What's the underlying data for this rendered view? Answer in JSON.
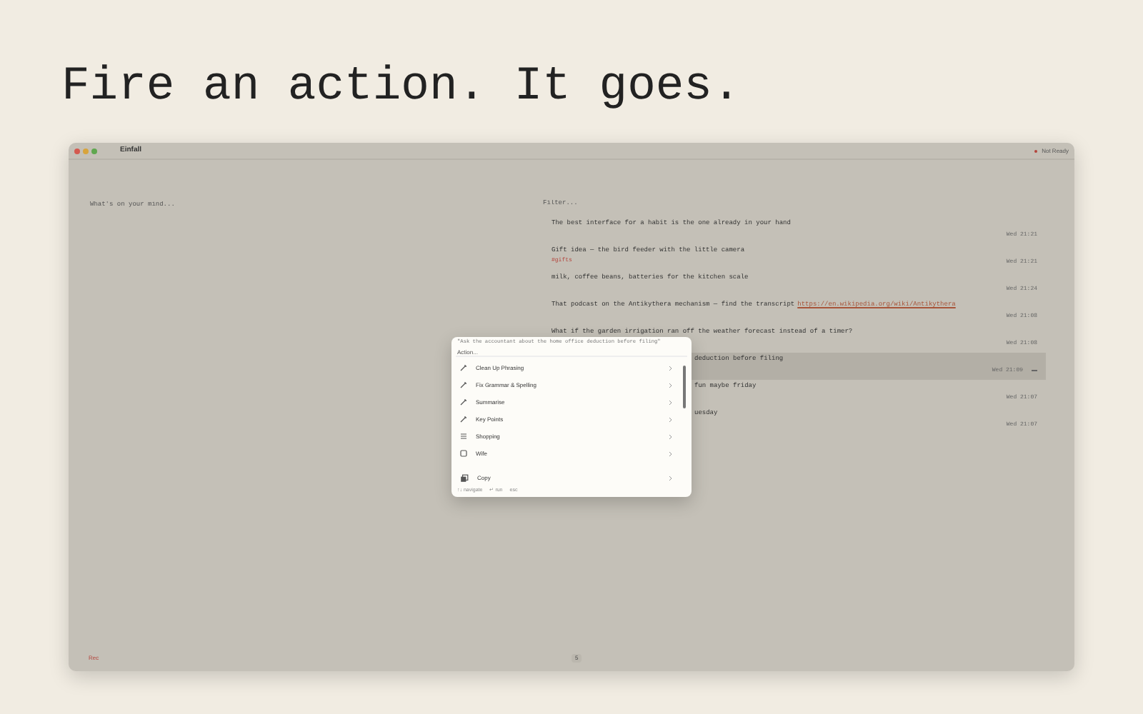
{
  "headline": "Fire an action. It goes.",
  "window": {
    "title": "Einfall",
    "status": "Not Ready"
  },
  "composer": {
    "placeholder": "What's on your mind..."
  },
  "filter": {
    "placeholder": "Filter..."
  },
  "notes": [
    {
      "text": "The best interface for a habit is the one already in your hand",
      "time": "Wed 21:21",
      "selected": false
    },
    {
      "text": "Gift idea — the bird feeder with the little camera",
      "tag": "#gifts",
      "time": "Wed 21:21",
      "selected": false
    },
    {
      "text": "milk, coffee beans, batteries for the kitchen scale",
      "time": "Wed 21:24",
      "selected": false
    },
    {
      "text": "That podcast on the Antikythera mechanism — find the transcript",
      "link": "https://en.wikipedia.org/wiki/Antikythera",
      "time": "Wed 21:08",
      "selected": false
    },
    {
      "text": "What if the garden irrigation ran off the weather forecast instead of a timer?",
      "time": "Wed 21:08",
      "selected": false
    },
    {
      "text": "deduction before filing",
      "time": "Wed 21:09",
      "selected": true,
      "kind": "overlapped"
    },
    {
      "text": "fun maybe friday",
      "time": "Wed 21:07",
      "selected": false,
      "kind": "overlapped"
    },
    {
      "text": "uesday",
      "time": "Wed 21:07",
      "selected": false,
      "kind": "overlapped"
    }
  ],
  "palette": {
    "query": "\"Ask the accountant about the home office deduction before filing\"",
    "placeholder": "Action...",
    "items": [
      {
        "label": "Clean Up Phrasing",
        "kind": "ai"
      },
      {
        "label": "Fix Grammar & Spelling",
        "kind": "ai"
      },
      {
        "label": "Summarise",
        "kind": "ai"
      },
      {
        "label": "Key Points",
        "kind": "ai"
      },
      {
        "label": "Shopping",
        "kind": "list"
      },
      {
        "label": "Wife",
        "kind": "box"
      },
      {
        "label": "Copy",
        "kind": "copy"
      }
    ],
    "footer": [
      "↑↓ navigate",
      "↵ run",
      "esc"
    ]
  },
  "bottom": {
    "left": "Rec",
    "center": "5"
  }
}
